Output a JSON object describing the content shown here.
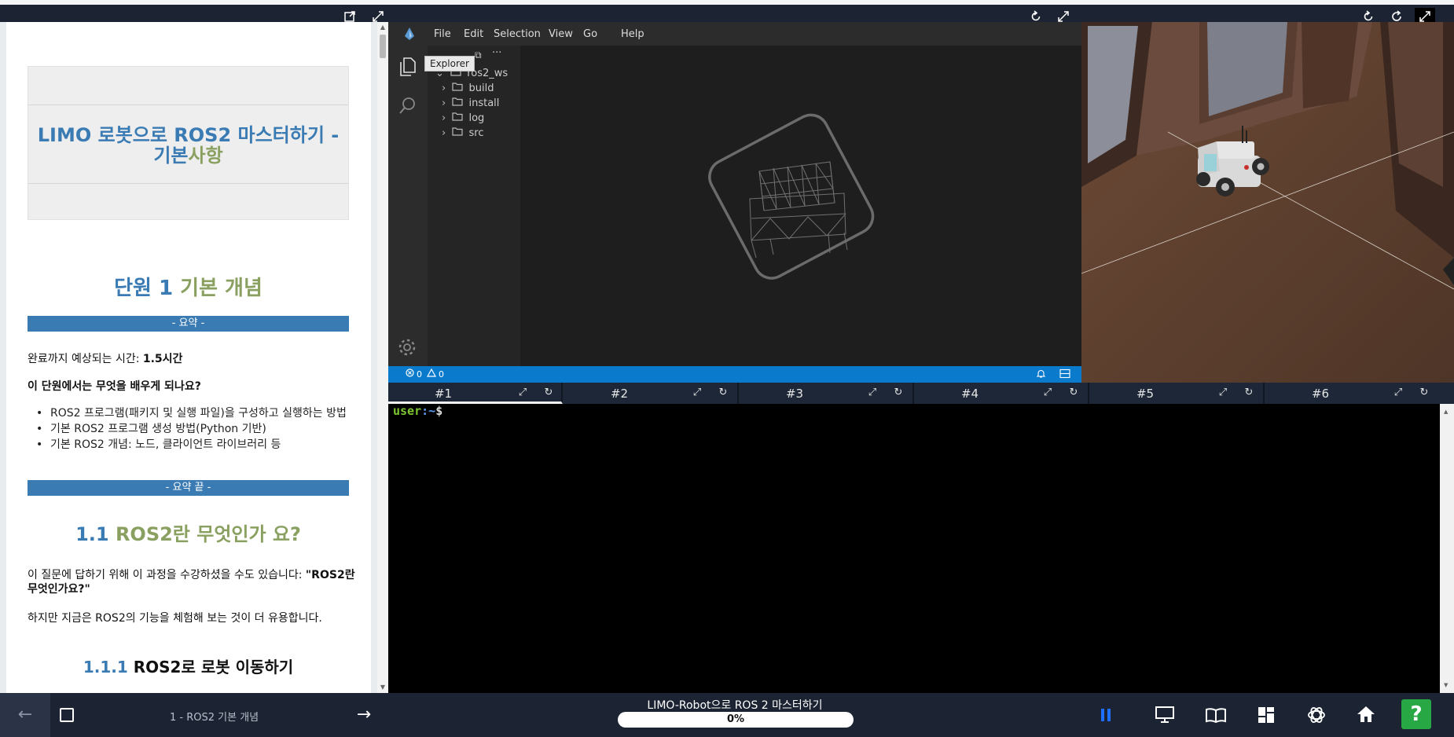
{
  "left_panel": {
    "title_part1": "LIMO 로봇으로 ROS2 마스터하기 - 기본",
    "title_part2": "사항",
    "unit_number": "단원 1",
    "unit_name": "기본 개념",
    "summary_label": "- 요약 -",
    "time_label": "완료까지 예상되는 시간: ",
    "time_value": "1.5시간",
    "learn_heading": "이 단원에서는 무엇을 배우게 되나요?",
    "bullets": [
      "ROS2 프로그램(패키지 및 실행 파일)을 구성하고 실행하는 방법",
      "기본 ROS2 프로그램 생성 방법(Python 기반)",
      "기본 ROS2 개념: 노드, 클라이언트 라이브러리 등"
    ],
    "summary_end_label": "- 요약 끝 -",
    "section_num": "1.1",
    "section_title": "ROS2란 무엇인가 요?",
    "para1_a": "이 질문에 답하기 위해 이 과정을 수강하셨을 수도 있습니다: ",
    "para1_b": "\"ROS2란 무엇인가요?\"",
    "para2": "하지만 지금은 ROS2의 기능을 체험해 보는 것이 더 유용합니다.",
    "subsection_num": "1.1.1",
    "subsection_title": "ROS2로 로봇 이동하기"
  },
  "ide": {
    "menu": [
      "File",
      "Edit",
      "Selection",
      "View",
      "Go",
      "Help"
    ],
    "tooltip": "Explorer",
    "more": "···",
    "tree_root": "ros2_ws",
    "tree_items": [
      "build",
      "install",
      "log",
      "src"
    ],
    "errors": "0",
    "warnings": "0",
    "icons": {
      "explorer": "files-icon",
      "search": "search-icon",
      "settings": "gear-icon"
    }
  },
  "terminal": {
    "tabs": [
      "#1",
      "#2",
      "#3",
      "#4",
      "#5",
      "#6"
    ],
    "active_tab": 0,
    "prompt_user": "user",
    "prompt_path": ":~",
    "prompt_sym": "$"
  },
  "bottom": {
    "lesson": "1 - ROS2 기본 개념",
    "course_title": "LIMO-Robot으로 ROS 2 마스터하기",
    "progress_text": "0%",
    "progress": 0,
    "help": "?"
  },
  "colors": {
    "accent_blue": "#3a7bb4",
    "accent_green": "#8aa060",
    "status_blue": "#0a7acc",
    "help_green": "#28a745",
    "prompt_green": "#7ec630"
  }
}
